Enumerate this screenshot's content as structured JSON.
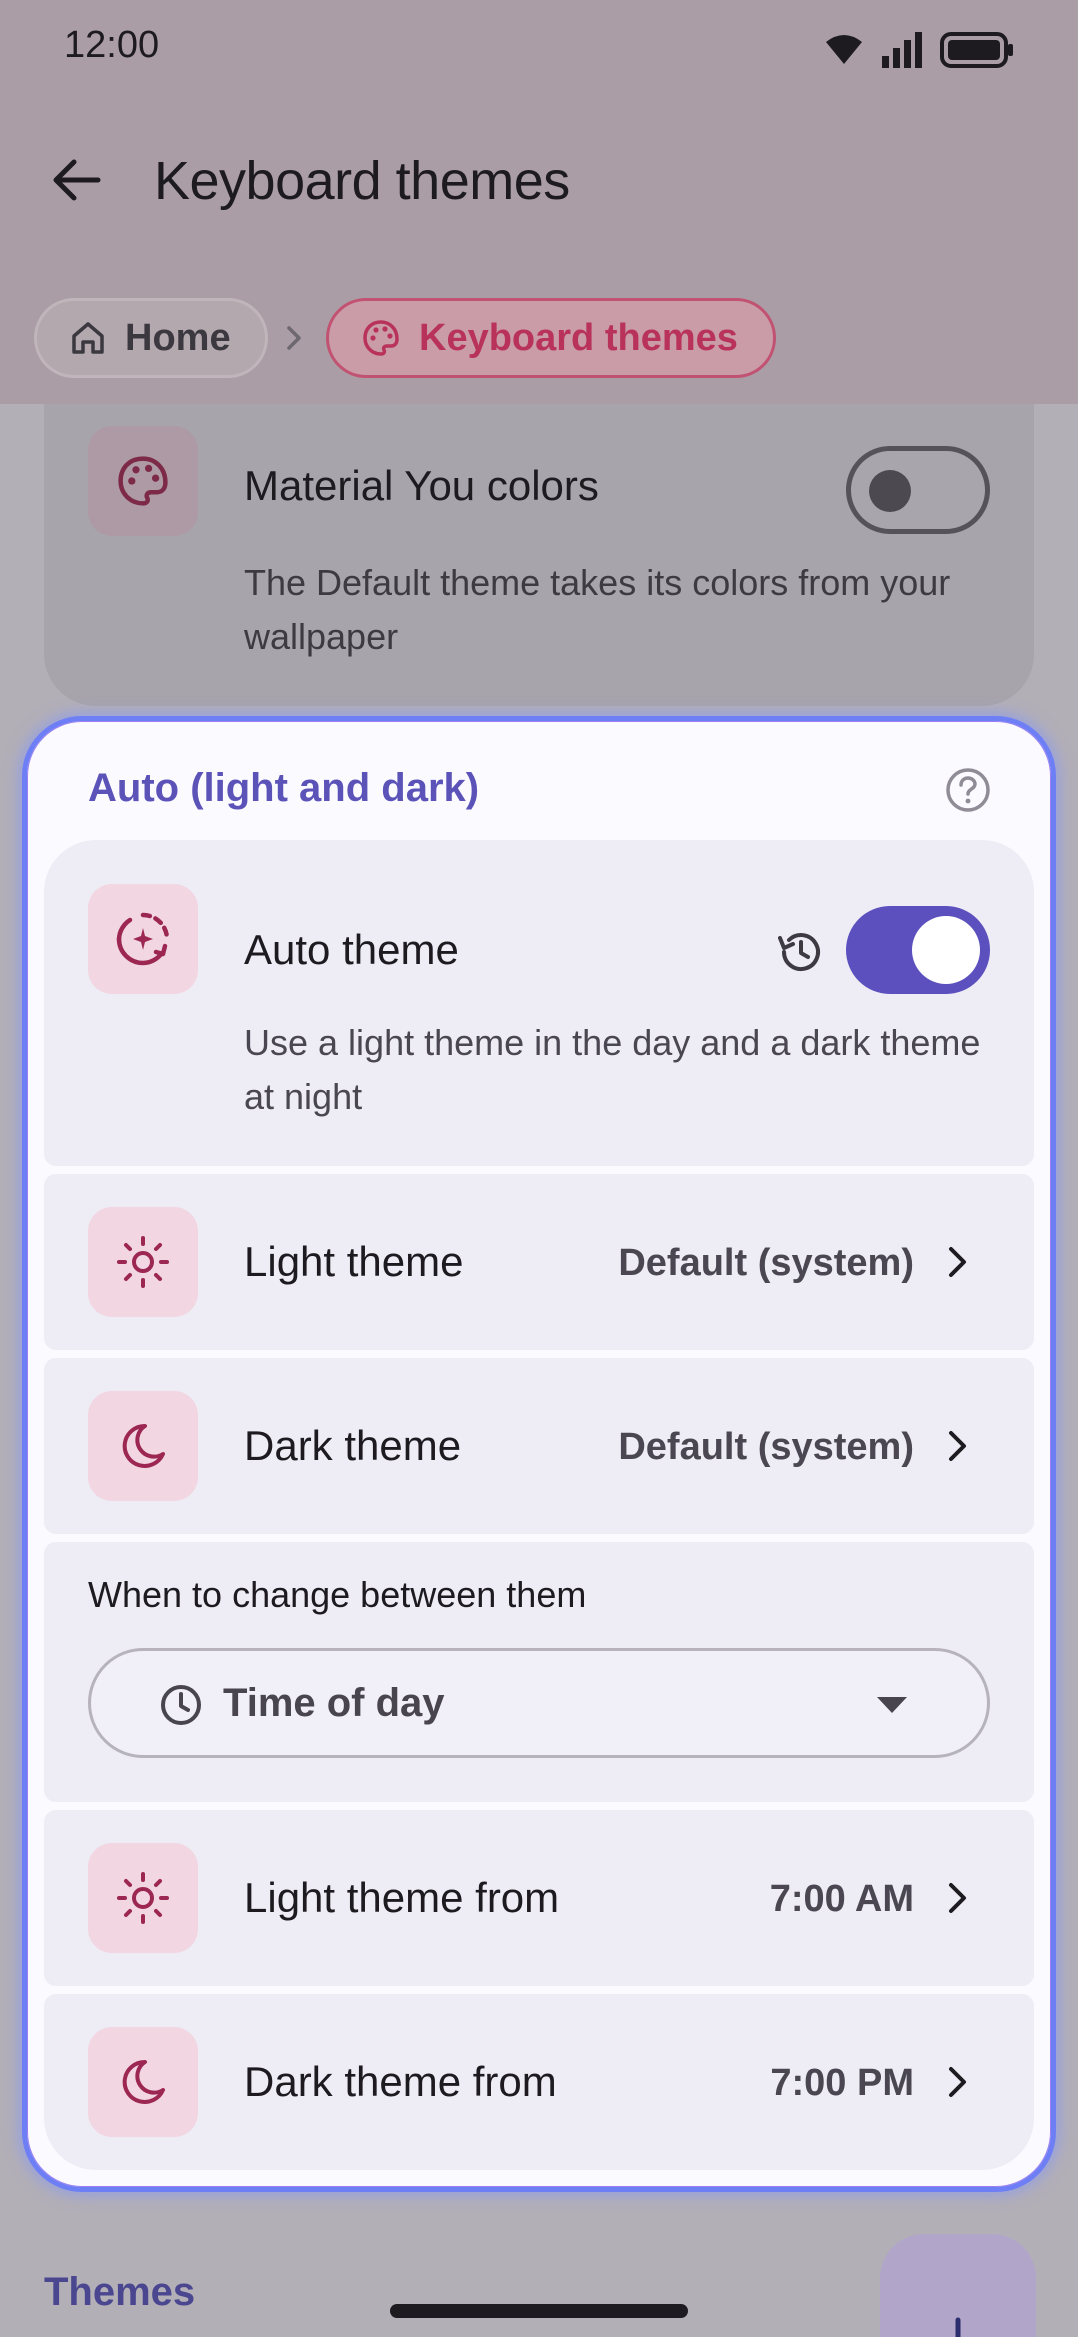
{
  "status_bar": {
    "time": "12:00"
  },
  "app_bar": {
    "title": "Keyboard themes"
  },
  "breadcrumb": {
    "home": "Home",
    "current": "Keyboard themes"
  },
  "material_card": {
    "title": "Material You colors",
    "subtitle": "The Default theme takes its colors from your wallpaper",
    "toggle_on": false
  },
  "auto_section": {
    "title": "Auto (light and dark)",
    "auto_theme": {
      "title": "Auto theme",
      "subtitle": "Use a light theme in the day and a dark theme at night",
      "toggle_on": true
    },
    "light_theme": {
      "title": "Light theme",
      "value": "Default (system)"
    },
    "dark_theme": {
      "title": "Dark theme",
      "value": "Default (system)"
    },
    "when": {
      "label": "When to change between them",
      "selected": "Time of day"
    },
    "light_from": {
      "title": "Light theme from",
      "value": "7:00 AM"
    },
    "dark_from": {
      "title": "Dark theme from",
      "value": "7:00 PM"
    }
  },
  "themes_section": {
    "title": "Themes"
  },
  "colors": {
    "accent": "#5b50bd",
    "pink_icon": "#9c2752",
    "panel_border": "#6e7ff6"
  }
}
